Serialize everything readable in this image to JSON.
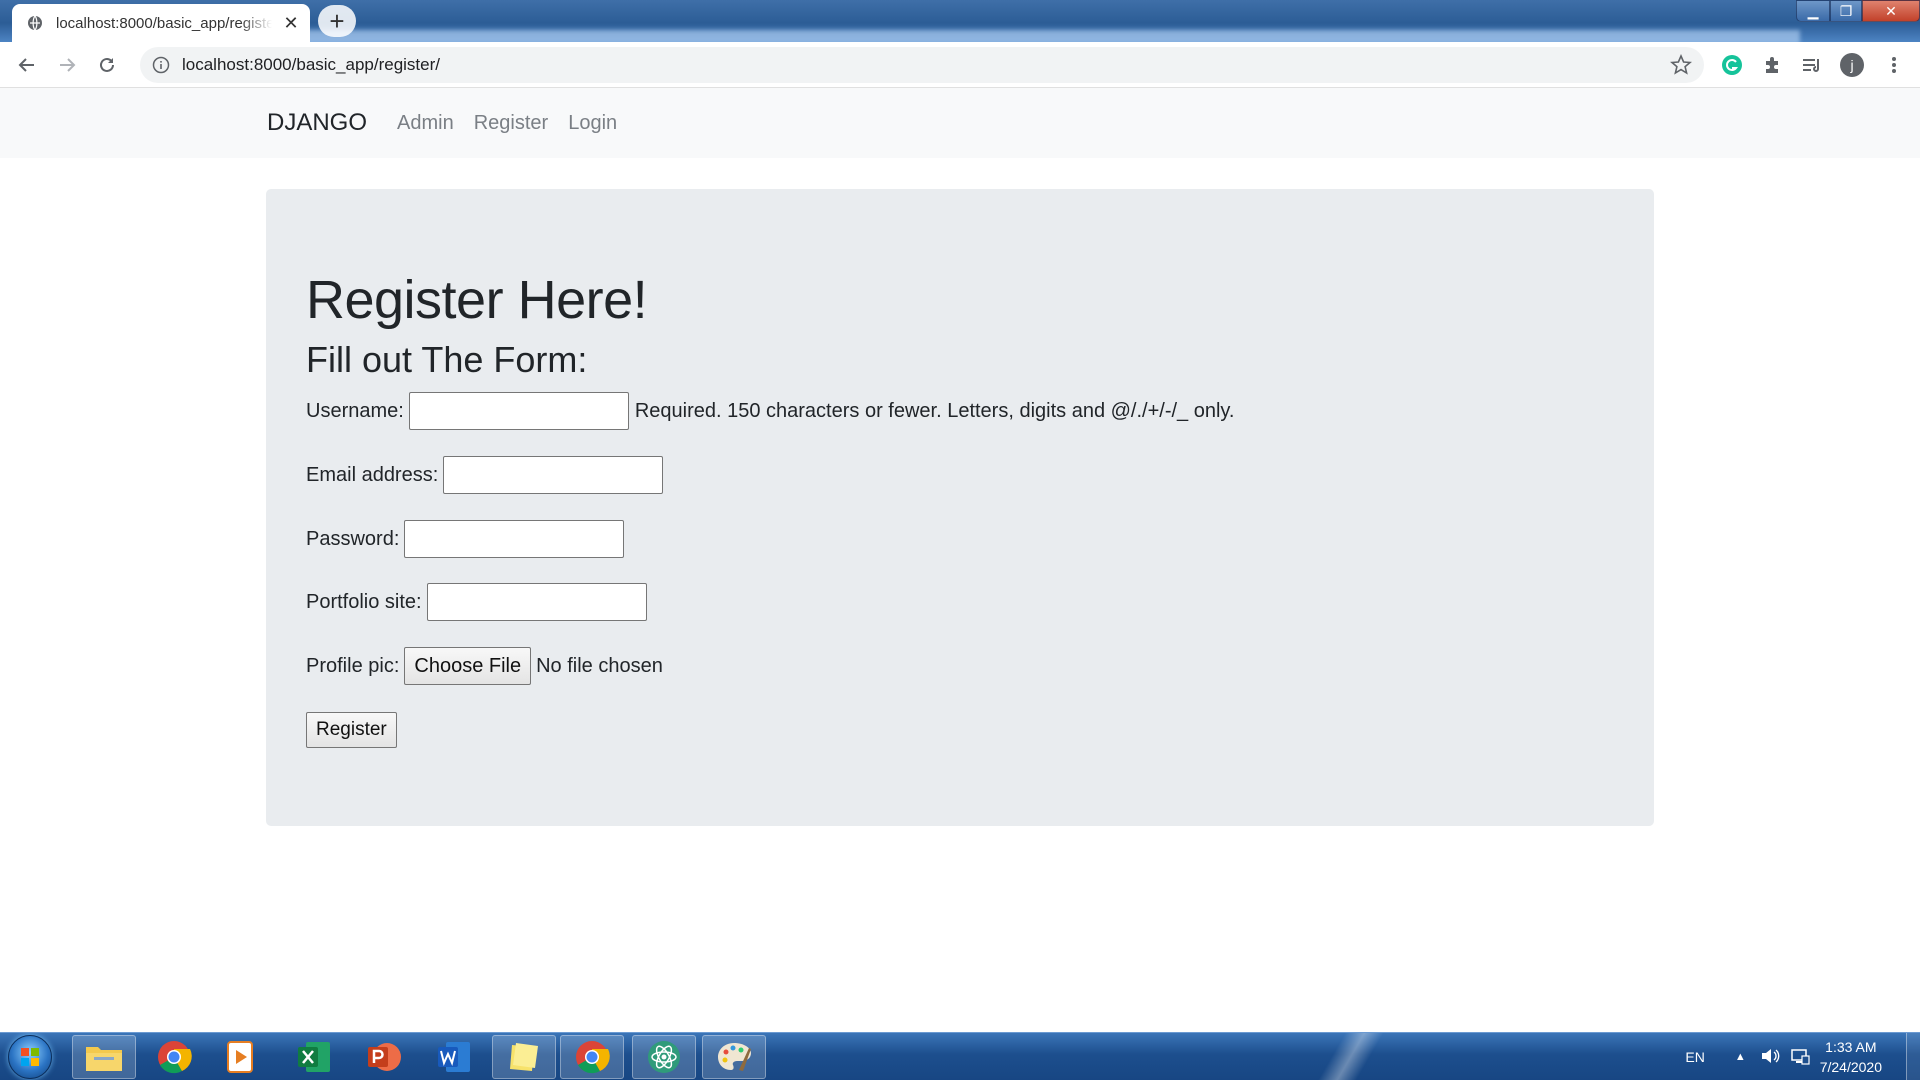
{
  "browser": {
    "tab_title": "localhost:8000/basic_app/register/",
    "url": "localhost:8000/basic_app/register/",
    "profile_initial": "j"
  },
  "navbar": {
    "brand": "DJANGO",
    "links": [
      "Admin",
      "Register",
      "Login"
    ]
  },
  "form": {
    "heading": "Register Here!",
    "subheading": "Fill out The Form:",
    "username_label": "Username:",
    "username_help": "Required. 150 characters or fewer. Letters, digits and @/./+/-/_ only.",
    "email_label": "Email address:",
    "password_label": "Password:",
    "portfolio_label": "Portfolio site:",
    "profile_pic_label": "Profile pic:",
    "choose_file_label": "Choose File",
    "no_file_text": "No file chosen",
    "submit_label": "Register"
  },
  "taskbar": {
    "apps": [
      "file-explorer",
      "chrome",
      "media-player",
      "excel",
      "powerpoint",
      "word",
      "sticky-notes",
      "chrome",
      "atom",
      "paint"
    ],
    "language": "EN",
    "time": "1:33 AM",
    "date": "7/24/2020"
  },
  "colors": {
    "jumbotron_bg": "#e9ecef",
    "navbar_bg": "#f8f9fa",
    "taskbar": "#1d4f8e",
    "grammarly": "#15c39a"
  }
}
